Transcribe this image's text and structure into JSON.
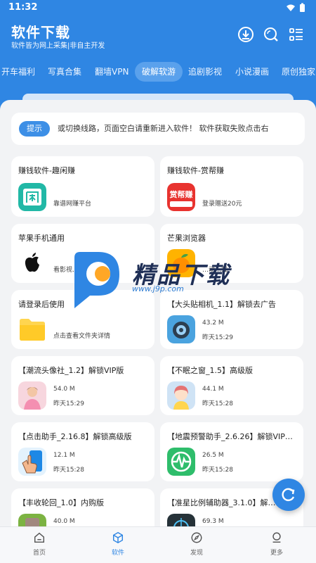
{
  "status_bar": {
    "time": "11:32"
  },
  "header": {
    "title": "软件下载",
    "subtitle": "软件皆为网上采集|非自主开发",
    "icons": [
      "download-icon",
      "search-icon",
      "menu-list-icon"
    ],
    "color": "#2f86e3"
  },
  "tabs": [
    {
      "label": "开车福利",
      "active": false
    },
    {
      "label": "写真合集",
      "active": false
    },
    {
      "label": "翻墙VPN",
      "active": false
    },
    {
      "label": "破解软游",
      "active": true
    },
    {
      "label": "追剧影视",
      "active": false
    },
    {
      "label": "小说漫画",
      "active": false
    },
    {
      "label": "原创独家",
      "active": false
    }
  ],
  "notice": {
    "badge": "提示",
    "text": "或切换线路，页面空白请重新进入软件！ 软件获取失败点击右"
  },
  "cards": [
    {
      "title": "赚钱软件-趣闲赚",
      "desc": "靠谱网赚平台",
      "icon": "quxianzhuan-app-icon"
    },
    {
      "title": "赚钱软件-赏帮赚",
      "desc": "登录赠送20元",
      "icon": "shangbangzhuan-app-icon"
    },
    {
      "title": "苹果手机通用",
      "desc": "看影视…蓝",
      "icon": "apple-logo-icon"
    },
    {
      "title": "芒果浏览器",
      "desc": "…动…载",
      "icon": "mango-browser-icon"
    },
    {
      "title": "请登录后使用",
      "desc": "点击查看文件夹详情",
      "icon": "folder-icon"
    },
    {
      "title": "【大头贴相机_1.1】解锁去广告",
      "size": "43.2 M",
      "date": "昨天15:29",
      "icon": "camera-app-icon"
    },
    {
      "title": "【潮流头像社_1.2】解锁VIP版",
      "size": "54.0 M",
      "date": "昨天15:29",
      "icon": "avatar-app-icon"
    },
    {
      "title": "【不眠之窗_1.5】高级版",
      "size": "44.1 M",
      "date": "昨天15:28",
      "icon": "anime-girl-app-icon"
    },
    {
      "title": "【点击助手_2.16.8】解锁高级版",
      "size": "12.1 M",
      "date": "昨天15:28",
      "icon": "tap-assistant-app-icon"
    },
    {
      "title": "【地震预警助手_2.6.26】解锁VIP…",
      "size": "26.5 M",
      "date": "昨天15:28",
      "icon": "earthquake-alert-app-icon"
    },
    {
      "title": "【丰收轮回_1.0】内购版",
      "size": "40.0 M",
      "icon": "harvest-game-app-icon"
    },
    {
      "title": "【准星比例辅助器_3.1.0】解…",
      "size": "69.3 M",
      "icon": "crosshair-app-icon"
    }
  ],
  "watermark": {
    "text": "精品下载",
    "url": "www.j9p.com"
  },
  "bottom_nav": [
    {
      "label": "首页",
      "icon": "home-icon",
      "active": false
    },
    {
      "label": "软件",
      "icon": "cube-icon",
      "active": true
    },
    {
      "label": "发现",
      "icon": "compass-icon",
      "active": false
    },
    {
      "label": "更多",
      "icon": "user-icon",
      "active": false
    }
  ]
}
